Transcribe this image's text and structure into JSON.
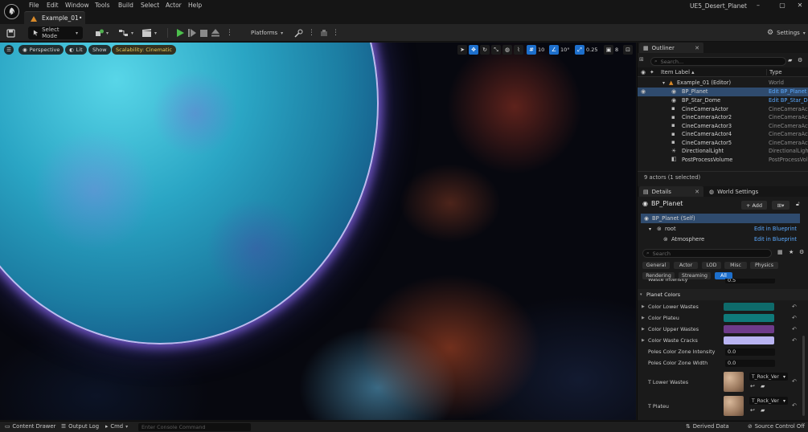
{
  "window": {
    "menu": [
      "File",
      "Edit",
      "Window",
      "Tools",
      "Build",
      "Select",
      "Actor",
      "Help"
    ],
    "doc_tab": "Example_01•",
    "project_name": "UE5_Desert_Planet",
    "controls": {
      "minimize": "–",
      "maximize": "▢",
      "close": "✕"
    }
  },
  "toolbar": {
    "select_mode": "Select Mode",
    "platforms": "Platforms",
    "settings": "Settings"
  },
  "viewport": {
    "perspective": "Perspective",
    "lit": "Lit",
    "show": "Show",
    "scalability": "Scalability: Cinematic",
    "grid_snap": "10",
    "rot_snap": "10°",
    "scale_snap": "0.25",
    "cam_speed": "8"
  },
  "outliner": {
    "tab": "Outliner",
    "search_placeholder": "Search...",
    "col_label": "Item Label ▴",
    "col_type": "Type",
    "rows": [
      {
        "label": "Example_01 (Editor)",
        "type": "World",
        "link": false
      },
      {
        "label": "BP_Planet",
        "type": "Edit BP_Planet",
        "link": true
      },
      {
        "label": "BP_Star_Dome",
        "type": "Edit BP_Star_Do",
        "link": true
      },
      {
        "label": "CineCameraActor",
        "type": "CineCameraActo",
        "link": false
      },
      {
        "label": "CineCameraActor2",
        "type": "CineCameraActo",
        "link": false
      },
      {
        "label": "CineCameraActor3",
        "type": "CineCameraActo",
        "link": false
      },
      {
        "label": "CineCameraActor4",
        "type": "CineCameraActo",
        "link": false
      },
      {
        "label": "CineCameraActor5",
        "type": "CineCameraActo",
        "link": false
      },
      {
        "label": "DirectionalLight",
        "type": "DirectionalLight",
        "link": false
      },
      {
        "label": "PostProcessVolume",
        "type": "PostProcessVolu",
        "link": false
      }
    ],
    "footer": "9 actors (1 selected)"
  },
  "details": {
    "tab": "Details",
    "world_settings_tab": "World Settings",
    "actor_name": "BP_Planet",
    "add_label": "+ Add",
    "components": [
      {
        "label": "BP_Planet (Self)",
        "edit": ""
      },
      {
        "label": "root",
        "edit": "Edit in Blueprint"
      },
      {
        "label": "Atmosphere",
        "edit": "Edit in Blueprint"
      }
    ],
    "search_placeholder": "Search",
    "categories_row1": [
      "General",
      "Actor",
      "LOD",
      "Misc",
      "Physics"
    ],
    "categories_row2": [
      "Rendering",
      "Streaming",
      "All"
    ],
    "partial_prop": {
      "label": "Waste Intensity",
      "value": "0.5"
    },
    "section": "Planet Colors",
    "color_props": [
      {
        "label": "Color Lower Wastes",
        "color": "#0e6a6a"
      },
      {
        "label": "Color Plateu",
        "color": "#0f7a7a"
      },
      {
        "label": "Color Upper Wastes",
        "color": "#6e3b8a"
      },
      {
        "label": "Color Waste Cracks",
        "color": "#b9b4f2"
      }
    ],
    "num_props": [
      {
        "label": "Poles Color Zone Intensity",
        "value": "0.0"
      },
      {
        "label": "Poles Color Zone Width",
        "value": "0.0"
      }
    ],
    "texture_props": [
      {
        "label": "T Lower Wastes",
        "value": "T_Rock_Ver"
      },
      {
        "label": "T Plateu",
        "value": "T_Rock_Ver"
      }
    ]
  },
  "statusbar": {
    "content_drawer": "Content Drawer",
    "output_log": "Output Log",
    "cmd": "Cmd",
    "console_placeholder": "Enter Console Command",
    "derived_data": "Derived Data",
    "source_control": "Source Control Off"
  }
}
